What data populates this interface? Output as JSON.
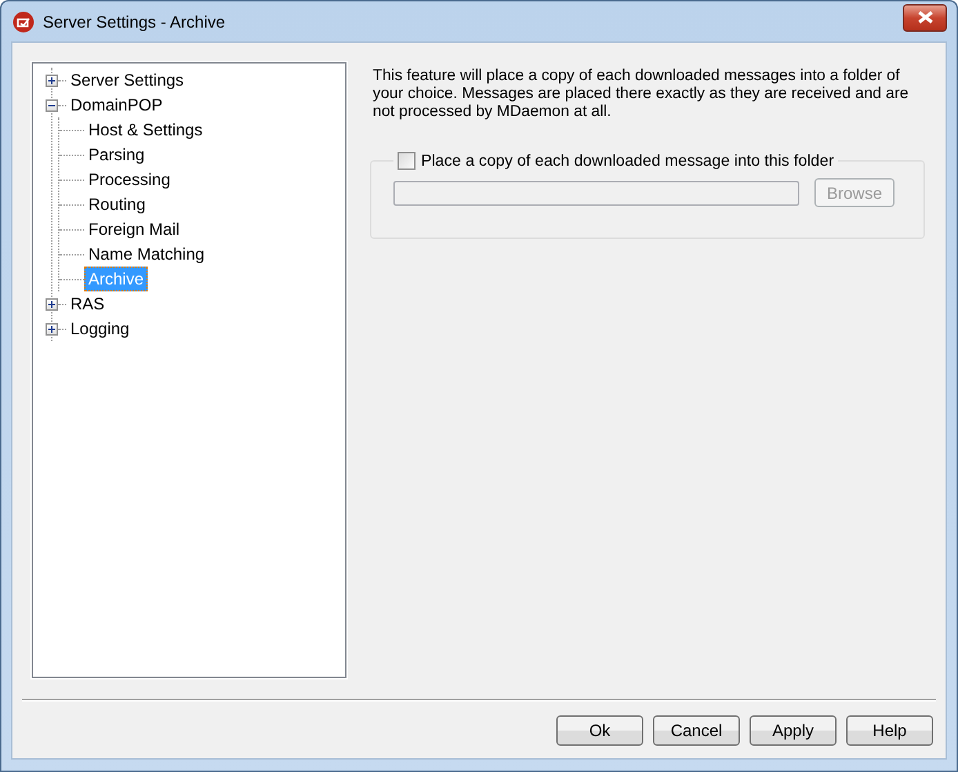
{
  "window": {
    "title": "Server Settings - Archive"
  },
  "tree": [
    {
      "label": "Server Settings",
      "expanded": false,
      "selected": false
    },
    {
      "label": "DomainPOP",
      "expanded": true,
      "selected": false,
      "children": [
        {
          "label": "Host & Settings",
          "selected": false
        },
        {
          "label": "Parsing",
          "selected": false
        },
        {
          "label": "Processing",
          "selected": false
        },
        {
          "label": "Routing",
          "selected": false
        },
        {
          "label": "Foreign Mail",
          "selected": false
        },
        {
          "label": "Name Matching",
          "selected": false
        },
        {
          "label": "Archive",
          "selected": true
        }
      ]
    },
    {
      "label": "RAS",
      "expanded": false,
      "selected": false
    },
    {
      "label": "Logging",
      "expanded": false,
      "selected": false
    }
  ],
  "description": "This feature will place a copy of each downloaded messages into a folder of your choice.  Messages are placed there exactly as they are received and are not processed by MDaemon at all.",
  "archive_group": {
    "checkbox": {
      "label": "Place a copy of each downloaded message into this folder",
      "checked": false
    },
    "folder_field": {
      "disabled": true
    },
    "browse_button": {
      "label": "Browse",
      "disabled": true
    }
  },
  "buttons": [
    "Ok",
    "Cancel",
    "Apply",
    "Help"
  ]
}
